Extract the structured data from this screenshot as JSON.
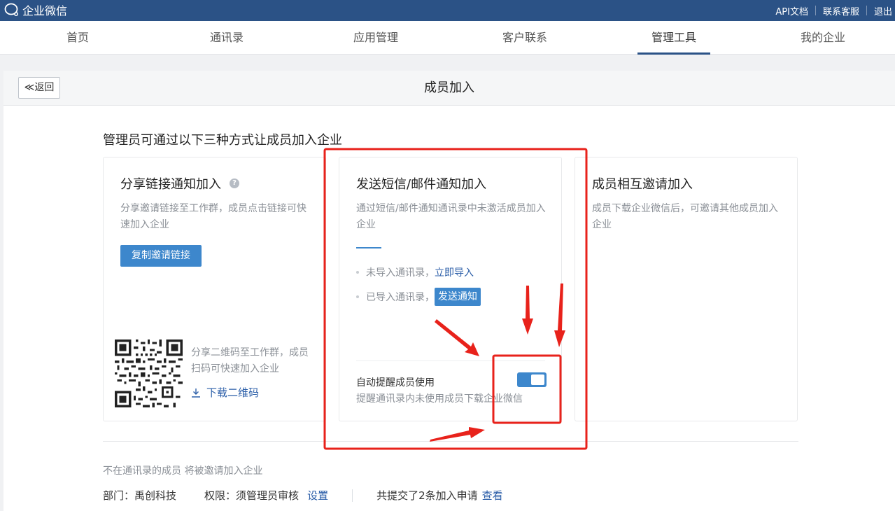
{
  "topbar": {
    "logo_text": "企业微信",
    "links": [
      "API文档",
      "联系客服",
      "退出"
    ]
  },
  "nav": {
    "items": [
      "首页",
      "通讯录",
      "应用管理",
      "客户联系",
      "管理工具",
      "我的企业"
    ],
    "active": "管理工具"
  },
  "page": {
    "back_label": "≪返回",
    "title": "成员加入",
    "intro": "管理员可通过以下三种方式让成员加入企业"
  },
  "card_share": {
    "title": "分享链接通知加入",
    "desc": "分享邀请链接至工作群，成员点击链接可快速加入企业",
    "copy_button": "复制邀请链接",
    "qr_text": "分享二维码至工作群，成员扫码可快速加入企业",
    "download_label": "下载二维码"
  },
  "card_sms": {
    "title": "发送短信/邮件通知加入",
    "desc": "通过短信/邮件通知通讯录中未激活成员加入企业",
    "row1_text": "未导入通讯录，",
    "row1_link": "立即导入",
    "row2_text": "已导入通讯录，",
    "row2_button": "发送通知",
    "auto_title": "自动提醒成员使用",
    "auto_desc": "提醒通讯录内未使用成员下载企业微信",
    "toggle_on": true
  },
  "card_invite": {
    "title": "成员相互邀请加入",
    "desc": "成员下载企业微信后，可邀请其他成员加入企业"
  },
  "footer": {
    "note": "不在通讯录的成员 将被邀请加入企业",
    "dept_label": "部门：",
    "dept_value": "禹创科技",
    "perm_label": "权限：",
    "perm_value": "须管理员审核",
    "perm_link": "设置",
    "requests_text": "共提交了2条加入申请",
    "requests_link": "查看"
  },
  "colors": {
    "topbar": "#2b5286",
    "accent": "#3d87cc",
    "link": "#2b5ea8",
    "annotation": "#e8221b"
  }
}
